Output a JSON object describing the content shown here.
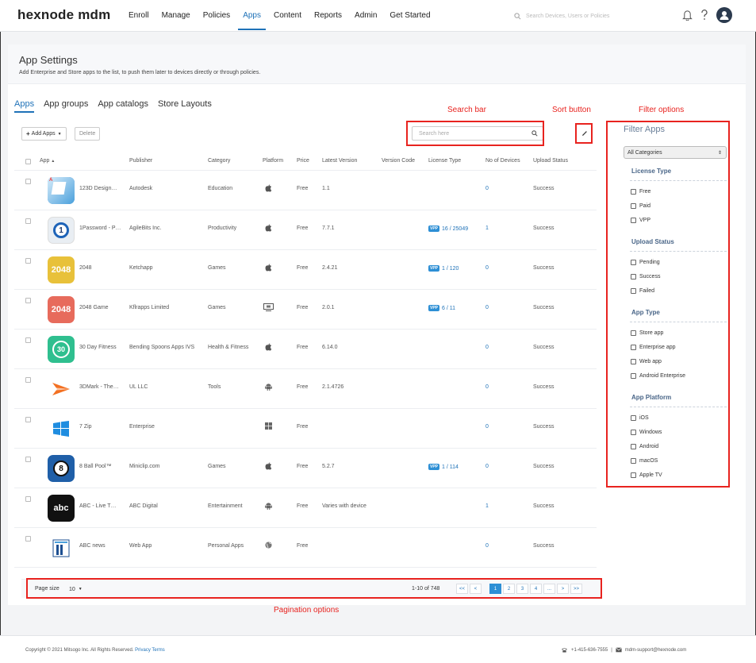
{
  "brand": {
    "logo": "hexnode mdm"
  },
  "nav": {
    "items": [
      "Enroll",
      "Manage",
      "Policies",
      "Apps",
      "Content",
      "Reports",
      "Admin",
      "Get Started"
    ],
    "active": "Apps"
  },
  "top_search": {
    "placeholder": "Search Devices, Users or Policies"
  },
  "page": {
    "title": "App Settings",
    "description": "Add Enterprise and Store apps to the list, to push them later to devices directly or through policies."
  },
  "tabs": [
    "Apps",
    "App groups",
    "App catalogs",
    "Store Layouts"
  ],
  "annotations": {
    "search_bar": "Search bar",
    "sort_button": "Sort button",
    "filter_options": "Filter options",
    "pagination_options": "Pagination options"
  },
  "toolbar": {
    "add_apps": "Add Apps",
    "delete": "Delete",
    "search_placeholder": "Search here"
  },
  "table": {
    "headers": [
      "App",
      "Publisher",
      "Category",
      "Platform",
      "Price",
      "Latest Version",
      "Version Code",
      "License Type",
      "No of Devices",
      "Upload Status"
    ],
    "rows": [
      {
        "app": "123D Design…",
        "publisher": "Autodesk",
        "category": "Education",
        "platform": "apple",
        "price": "Free",
        "version": "1.1",
        "vpp": "",
        "license": "",
        "devices": "0",
        "status": "Success",
        "icon_color": "#3a8fd1",
        "icon_text": ""
      },
      {
        "app": "1Password - P…",
        "publisher": "AgileBits Inc.",
        "category": "Productivity",
        "platform": "apple",
        "price": "Free",
        "version": "7.7.1",
        "vpp": "VPP",
        "license": "16 / 25049",
        "devices": "1",
        "status": "Success",
        "icon_color": "#e9eef3",
        "icon_text": "1"
      },
      {
        "app": "2048",
        "publisher": "Ketchapp",
        "category": "Games",
        "platform": "apple",
        "price": "Free",
        "version": "2.4.21",
        "vpp": "VPP",
        "license": "1 / 120",
        "devices": "0",
        "status": "Success",
        "icon_color": "#e8c13a",
        "icon_text": "2048"
      },
      {
        "app": "2048 Game",
        "publisher": "Kflrapps Limited",
        "category": "Games",
        "platform": "macos",
        "price": "Free",
        "version": "2.0.1",
        "vpp": "VPP",
        "license": "6 / 11",
        "devices": "0",
        "status": "Success",
        "icon_color": "#e76b5c",
        "icon_text": "2048"
      },
      {
        "app": "30 Day Fitness",
        "publisher": "Bending Spoons Apps IVS",
        "category": "Health & Fitness",
        "platform": "apple",
        "price": "Free",
        "version": "6.14.0",
        "vpp": "",
        "license": "",
        "devices": "0",
        "status": "Success",
        "icon_color": "#2fbf8f",
        "icon_text": "30"
      },
      {
        "app": "3DMark - The…",
        "publisher": "UL LLC",
        "category": "Tools",
        "platform": "android",
        "price": "Free",
        "version": "2.1.4726",
        "vpp": "",
        "license": "",
        "devices": "0",
        "status": "Success",
        "icon_color": "#ffffff",
        "icon_text": ""
      },
      {
        "app": "7 Zip",
        "publisher": "Enterprise",
        "category": "",
        "platform": "windows",
        "price": "Free",
        "version": "",
        "vpp": "",
        "license": "",
        "devices": "0",
        "status": "Success",
        "icon_color": "#ffffff",
        "icon_text": ""
      },
      {
        "app": "8 Ball Pool™",
        "publisher": "Miniclip.com",
        "category": "Games",
        "platform": "apple",
        "price": "Free",
        "version": "5.2.7",
        "vpp": "VPP",
        "license": "1 / 114",
        "devices": "0",
        "status": "Success",
        "icon_color": "#1f5fa8",
        "icon_text": "8"
      },
      {
        "app": "ABC - Live T…",
        "publisher": "ABC Digital",
        "category": "Entertainment",
        "platform": "android",
        "price": "Free",
        "version": "Varies with device",
        "vpp": "",
        "license": "",
        "devices": "1",
        "status": "Success",
        "icon_color": "#111111",
        "icon_text": "abc"
      },
      {
        "app": "ABC news",
        "publisher": "Web App",
        "category": "Personal Apps",
        "platform": "web",
        "price": "Free",
        "version": "",
        "vpp": "",
        "license": "",
        "devices": "0",
        "status": "Success",
        "icon_color": "#ffffff",
        "icon_text": ""
      }
    ]
  },
  "pagination": {
    "page_size_label": "Page size",
    "page_size": "10",
    "info": "1-10 of 748",
    "buttons": [
      "<<",
      "<",
      "1",
      "2",
      "3",
      "4",
      "...",
      ">",
      ">>"
    ],
    "active": "1"
  },
  "filter": {
    "title": "Filter Apps",
    "category_select": "All Categories",
    "groups": [
      {
        "title": "License Type",
        "options": [
          "Free",
          "Paid",
          "VPP"
        ]
      },
      {
        "title": "Upload Status",
        "options": [
          "Pending",
          "Success",
          "Failed"
        ]
      },
      {
        "title": "App Type",
        "options": [
          "Store app",
          "Enterprise app",
          "Web app",
          "Android Enterprise"
        ]
      },
      {
        "title": "App Platform",
        "options": [
          "iOS",
          "Windows",
          "Android",
          "macOS",
          "Apple TV"
        ]
      }
    ]
  },
  "footer": {
    "copyright": "Copyright © 2021 Mitsogo Inc. All Rights Reserved.",
    "privacy": "Privacy",
    "terms": "Terms",
    "phone": "+1-415-636-7555",
    "email": "mdm-support@hexnode.com"
  },
  "colors": {
    "accent": "#1f72b8",
    "annotation": "#e8231f",
    "vpp_badge": "#2d8fd5"
  }
}
